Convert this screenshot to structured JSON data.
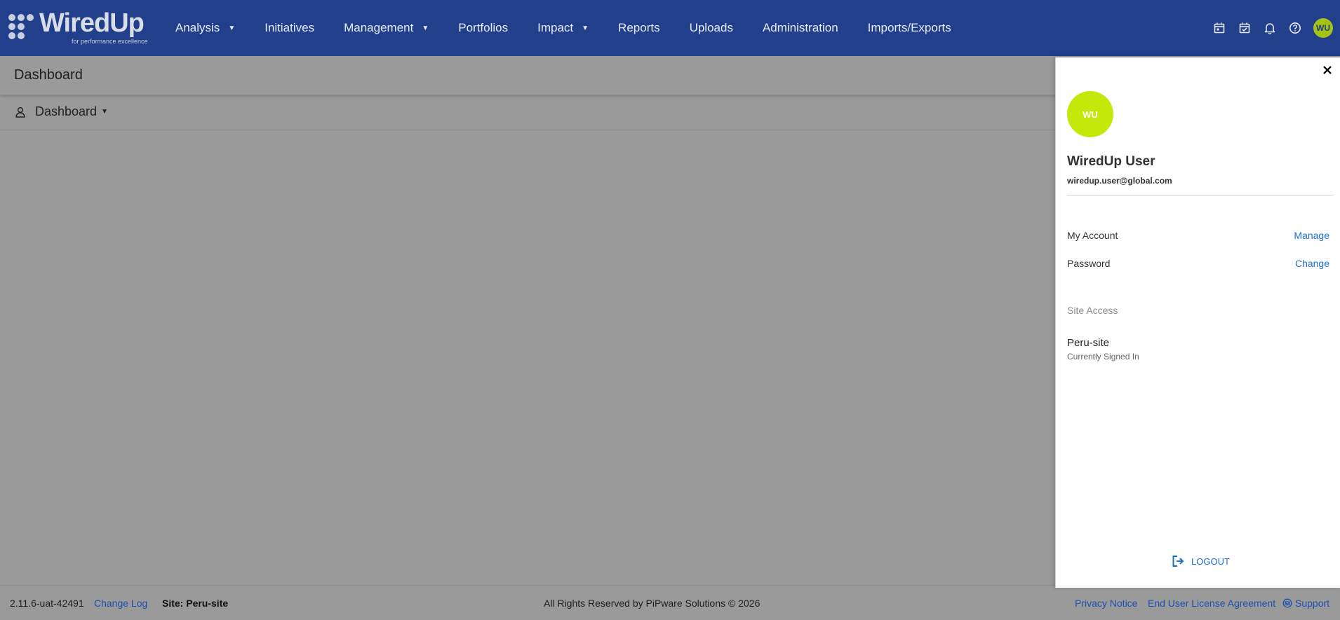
{
  "brand": {
    "name": "WiredUp",
    "tagline": "for performance excellence"
  },
  "nav": {
    "items": [
      {
        "label": "Analysis",
        "has_dropdown": true
      },
      {
        "label": "Initiatives",
        "has_dropdown": false
      },
      {
        "label": "Management",
        "has_dropdown": true
      },
      {
        "label": "Portfolios",
        "has_dropdown": false
      },
      {
        "label": "Impact",
        "has_dropdown": true
      },
      {
        "label": "Reports",
        "has_dropdown": false
      },
      {
        "label": "Uploads",
        "has_dropdown": false
      },
      {
        "label": "Administration",
        "has_dropdown": false
      },
      {
        "label": "Imports/Exports",
        "has_dropdown": false
      }
    ],
    "icons": [
      "calendar-icon",
      "calendar-check-icon",
      "bell-icon",
      "help-icon"
    ],
    "avatar_initials": "WU"
  },
  "page": {
    "title": "Dashboard",
    "dashboard_selector": "Dashboard"
  },
  "profile_panel": {
    "avatar_initials": "WU",
    "name": "WiredUp User",
    "email": "wiredup.user@global.com",
    "account_label": "My Account",
    "account_action": "Manage",
    "password_label": "Password",
    "password_action": "Change",
    "site_access_heading": "Site Access",
    "site_name": "Peru-site",
    "site_status": "Currently Signed In",
    "logout_label": "LOGOUT"
  },
  "footer": {
    "version": "2.11.6-uat-42491",
    "change_log": "Change Log",
    "site": "Site: Peru-site",
    "rights": "All Rights Reserved by PiPware Solutions © 2026",
    "privacy": "Privacy Notice",
    "eula": "End User License Agreement",
    "support": "Support"
  },
  "colors": {
    "navbar": "#213f8b",
    "overlay": "#9a9a9a",
    "avatar": "#c5e80b",
    "link": "#1b6fd0"
  }
}
